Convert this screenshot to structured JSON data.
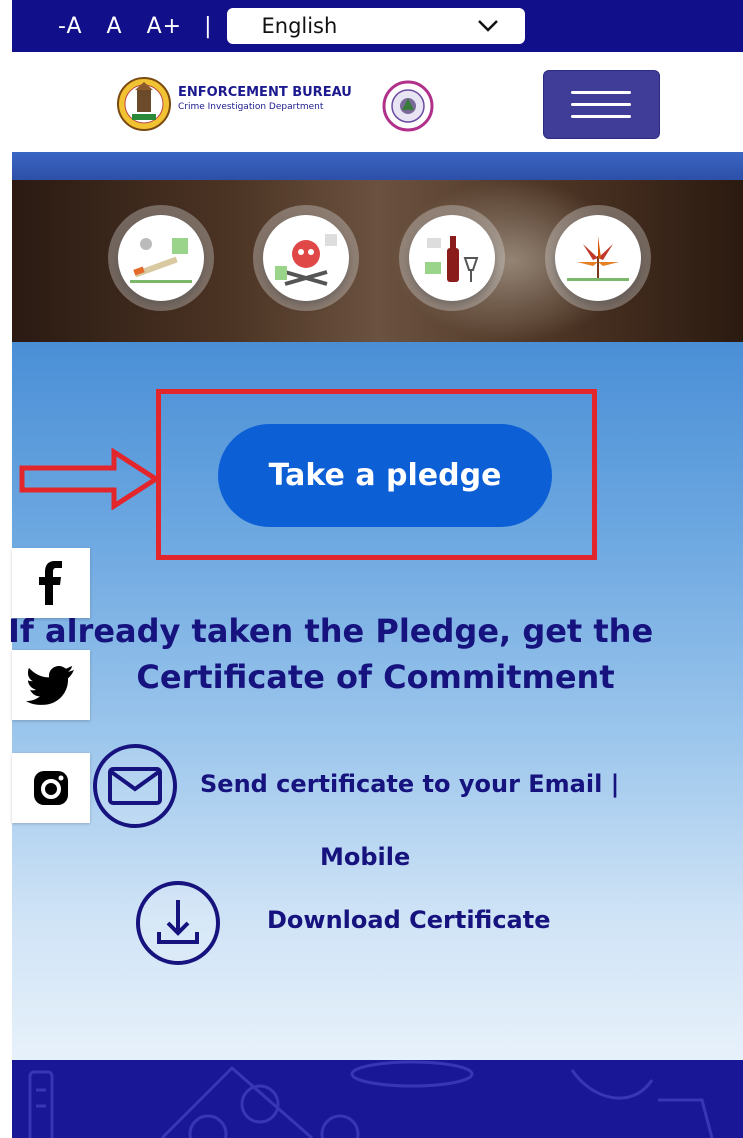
{
  "topbar": {
    "font_smaller": "-A",
    "font_normal": "A",
    "font_larger": "A+",
    "separator": "|",
    "language": "English"
  },
  "header": {
    "title": "ENFORCEMENT BUREAU",
    "subtitle": "Crime Investigation Department"
  },
  "main": {
    "pledge_button": "Take a pledge",
    "heading_line1": "If already taken the Pledge, get the",
    "heading_line2": "Certificate of Commitment",
    "email_link": "Send certificate to your Email |",
    "mobile_link": "Mobile",
    "download_link": "Download Certificate"
  },
  "banner_icons": [
    "smoking-icon",
    "poison-icon",
    "alcohol-icon",
    "cannabis-icon"
  ],
  "social": [
    "facebook-icon",
    "twitter-icon",
    "instagram-icon"
  ],
  "colors": {
    "topbar": "#120f8a",
    "menu_button": "#3f3d98",
    "pledge_button": "#0d5fd6",
    "heading_text": "#16127e",
    "highlight_box": "#e3262c",
    "footer": "#1a1797"
  }
}
